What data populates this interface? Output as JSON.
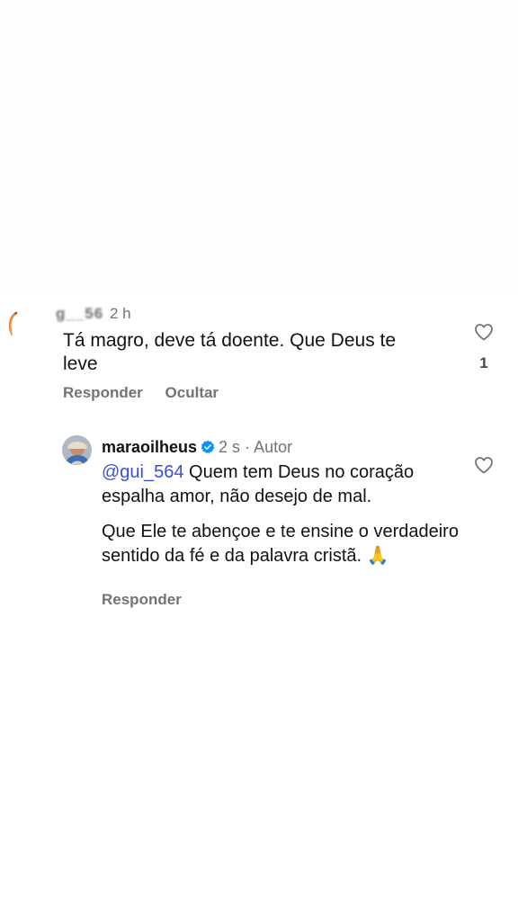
{
  "comment": {
    "username": "g__56",
    "time": "2 h",
    "text_line1": "Tá magro, deve tá doente. Que Deus te",
    "text_line2": "leve",
    "reply_action": "Responder",
    "hide_action": "Ocultar",
    "like_count": "1",
    "like_icon": "heart-outline-icon"
  },
  "reply": {
    "username": "maraoilheus",
    "verified_icon": "verified-badge-icon",
    "time": "2 s",
    "separator": "·",
    "author_label": "Autor",
    "mention": "@gui_564",
    "paragraph1_rest": " Quem tem Deus no coração espalha amor, não desejo de mal.",
    "paragraph2": "Que Ele te abençoe e te ensine o verdadeiro sentido da fé e da palavra cristã. 🙏",
    "reply_action": "Responder",
    "like_icon": "heart-outline-icon"
  },
  "colors": {
    "mention": "#3a4fd3",
    "verified": "#0095f6",
    "secondary_text": "#737373",
    "primary_text": "#121212"
  }
}
